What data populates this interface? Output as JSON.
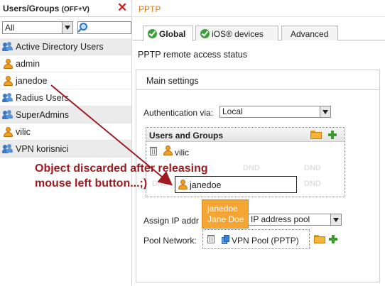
{
  "left_panel": {
    "title": "Users/Groups",
    "title_hint": "(OFF+V)",
    "close_icon": "close-icon",
    "filter": {
      "selected": "All",
      "search_value": ""
    },
    "items": [
      {
        "label": "Active Directory Users",
        "kind": "group"
      },
      {
        "label": "admin",
        "kind": "user"
      },
      {
        "label": "janedoe",
        "kind": "user"
      },
      {
        "label": "Radius Users",
        "kind": "group"
      },
      {
        "label": "SuperAdmins",
        "kind": "group"
      },
      {
        "label": "vilic",
        "kind": "user"
      },
      {
        "label": "VPN korisnici",
        "kind": "group"
      }
    ]
  },
  "right_panel": {
    "title": "PPTP",
    "tabs": [
      {
        "label": "Global",
        "active": true,
        "check": true
      },
      {
        "label": "iOS® devices",
        "active": false,
        "check": true
      },
      {
        "label": "Advanced",
        "active": false,
        "check": false
      }
    ],
    "status_text": "PPTP remote access status",
    "main_settings": {
      "heading": "Main settings",
      "auth_label": "Authentication via:",
      "auth_value": "Local",
      "users_groups": {
        "heading": "Users and Groups",
        "rows": [
          {
            "label": "vilic"
          }
        ],
        "dnd": [
          "DND",
          "DND",
          "DND",
          "DND"
        ]
      },
      "drag_item": "janedoe",
      "ip_label": "Assign IP addr",
      "ip_value": "IP address pool",
      "pool_label": "Pool Network:",
      "pool_value": "VPN Pool (PPTP)"
    }
  },
  "tooltip": {
    "line1": "janedoe",
    "line2": "Jane Doe"
  },
  "annotation": {
    "line1": "Object discarded after releasing",
    "line2": "mouse left button...;)"
  },
  "colors": {
    "accent_orange": "#e07a10",
    "annotation_red": "#9c1c22",
    "tooltip_bg": "#f5a533",
    "plus_green": "#3d9a2f"
  }
}
